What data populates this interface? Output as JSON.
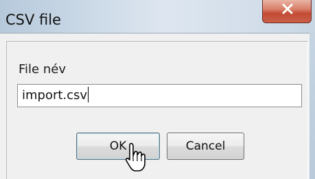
{
  "window": {
    "title": "CSV file"
  },
  "icons": {
    "close": "close-icon",
    "pointer": "mouse-pointer-icon"
  },
  "form": {
    "label": "File név",
    "input_value": "import.csv"
  },
  "buttons": {
    "ok_label": "OK",
    "cancel_label": "Cancel"
  },
  "colors": {
    "close_button": "#c34b34",
    "titlebar": "#cbd9e7",
    "client_background": "#f0f0f0",
    "ok_focus_ring": "#9ad6f2"
  }
}
